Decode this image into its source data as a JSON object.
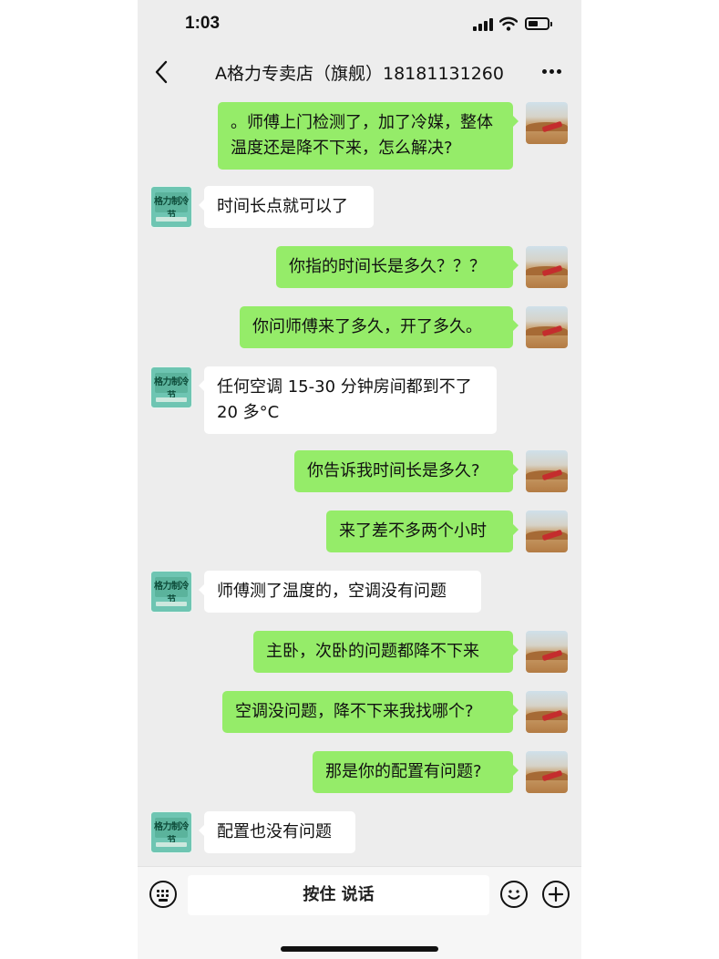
{
  "status_bar": {
    "time": "1:03",
    "battery_level": 0.55
  },
  "nav": {
    "title": "A格力专卖店（旗舰）18181131260",
    "back_icon": "chevron-left-icon",
    "more_icon": "more-dots-icon"
  },
  "avatars": {
    "me": "desert-photo-avatar",
    "them": {
      "icon": "gree-store-avatar",
      "brand_text": "格力制冷节"
    }
  },
  "messages": [
    {
      "from": "me",
      "text": "。师傅上门检测了，加了冷媒，整体温度还是降不下来，怎么解决?"
    },
    {
      "from": "them",
      "text": "时间长点就可以了"
    },
    {
      "from": "me",
      "text": "你指的时间长是多久？？？"
    },
    {
      "from": "me",
      "text": "你问师傅来了多久，开了多久。"
    },
    {
      "from": "them",
      "text": "任何空调 15-30 分钟房间都到不了 20 多°C"
    },
    {
      "from": "me",
      "text": "你告诉我时间长是多久?"
    },
    {
      "from": "me",
      "text": "来了差不多两个小时"
    },
    {
      "from": "them",
      "text": "师傅测了温度的，空调没有问题"
    },
    {
      "from": "me",
      "text": "主卧，次卧的问题都降不下来"
    },
    {
      "from": "me",
      "text": "空调没问题，降不下来我找哪个?"
    },
    {
      "from": "me",
      "text": "那是你的配置有问题?"
    },
    {
      "from": "them",
      "text": "配置也没有问题"
    }
  ],
  "input_bar": {
    "voice_label": "按住 说话",
    "left_icon": "keyboard-icon",
    "emoji_icon": "emoji-icon",
    "plus_icon": "plus-icon"
  }
}
